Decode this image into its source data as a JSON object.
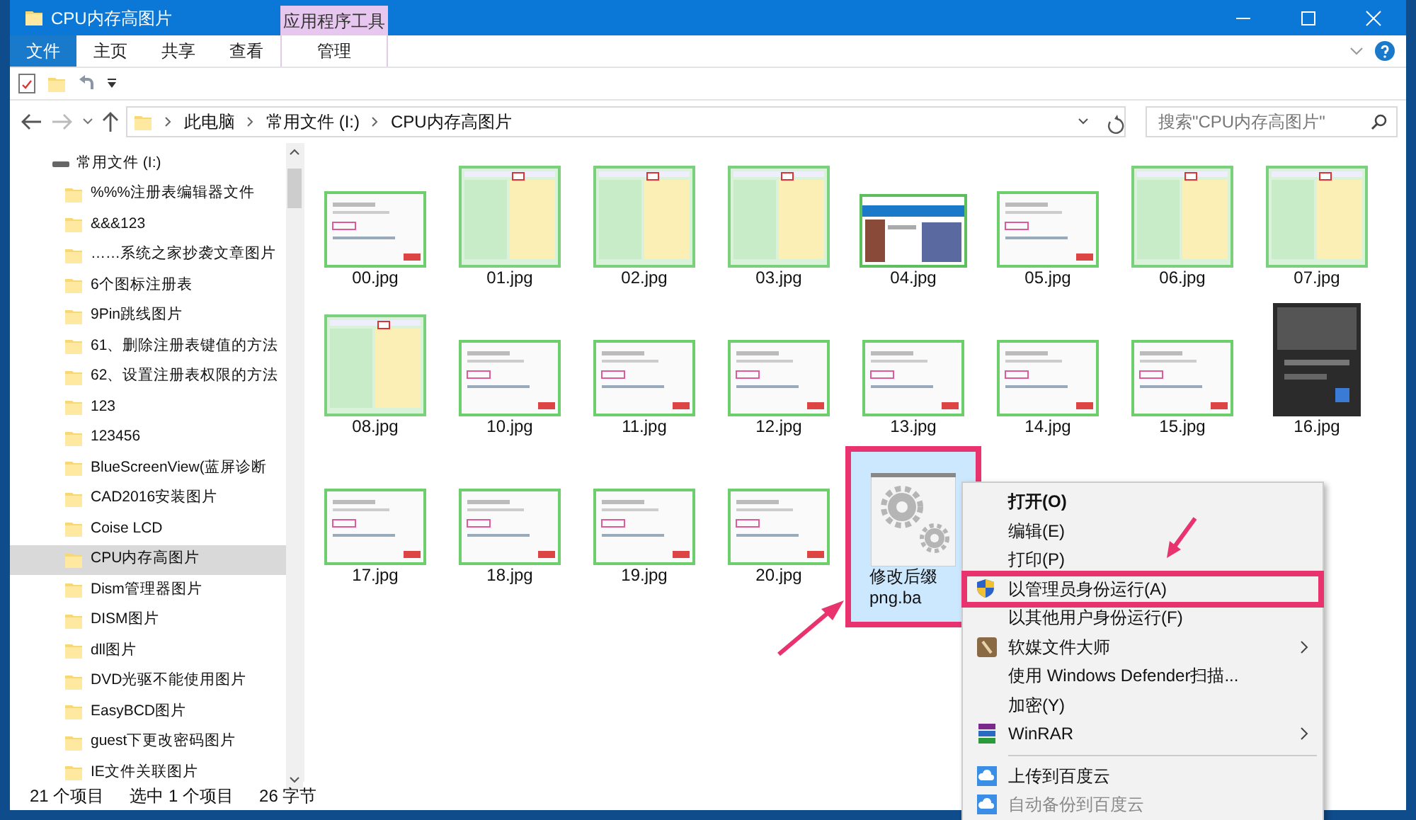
{
  "window": {
    "title": "CPU内存高图片",
    "context_group": "应用程序工具"
  },
  "ribbon_tabs": [
    {
      "label": "文件",
      "kind": "file",
      "selected": false
    },
    {
      "label": "主页",
      "kind": "normal",
      "selected": false
    },
    {
      "label": "共享",
      "kind": "normal",
      "selected": false
    },
    {
      "label": "查看",
      "kind": "normal",
      "selected": false
    },
    {
      "label": "管理",
      "kind": "contextual",
      "selected": false
    }
  ],
  "address_bar": {
    "breadcrumbs": [
      "此电脑",
      "常用文件 (I:)",
      "CPU内存高图片"
    ]
  },
  "search": {
    "placeholder": "搜索\"CPU内存高图片\""
  },
  "nav_tree": [
    {
      "label": "常用文件 (I:)",
      "kind": "drive",
      "selected": false,
      "children": [
        {
          "label": "%%%注册表编辑器文件",
          "kind": "folder",
          "selected": false
        },
        {
          "label": "&&&123",
          "kind": "folder",
          "selected": false
        },
        {
          "label": "……系统之家抄袭文章图片",
          "kind": "folder",
          "selected": false
        },
        {
          "label": "6个图标注册表",
          "kind": "folder",
          "selected": false
        },
        {
          "label": "9Pin跳线图片",
          "kind": "folder",
          "selected": false
        },
        {
          "label": "61、删除注册表键值的方法",
          "kind": "folder",
          "selected": false
        },
        {
          "label": "62、设置注册表权限的方法",
          "kind": "folder",
          "selected": false
        },
        {
          "label": "123",
          "kind": "folder",
          "selected": false
        },
        {
          "label": "123456",
          "kind": "folder",
          "selected": false
        },
        {
          "label": "BlueScreenView(蓝屏诊断",
          "kind": "folder",
          "selected": false
        },
        {
          "label": "CAD2016安装图片",
          "kind": "folder",
          "selected": false
        },
        {
          "label": "Coise LCD",
          "kind": "folder",
          "selected": false
        },
        {
          "label": "CPU内存高图片",
          "kind": "folder",
          "selected": true
        },
        {
          "label": "Dism管理器图片",
          "kind": "folder",
          "selected": false
        },
        {
          "label": "DISM图片",
          "kind": "folder",
          "selected": false
        },
        {
          "label": "dll图片",
          "kind": "folder",
          "selected": false
        },
        {
          "label": "DVD光驱不能使用图片",
          "kind": "folder",
          "selected": false
        },
        {
          "label": "EasyBCD图片",
          "kind": "folder",
          "selected": false
        },
        {
          "label": "guest下更改密码图片",
          "kind": "folder",
          "selected": false
        },
        {
          "label": "IE文件关联图片",
          "kind": "folder",
          "selected": false
        }
      ]
    }
  ],
  "files": [
    {
      "name_lines": [
        "00.jpg"
      ],
      "kind": "picture",
      "selected": false,
      "highlighted": false
    },
    {
      "name_lines": [
        "01.jpg"
      ],
      "kind": "picture",
      "selected": false,
      "highlighted": false
    },
    {
      "name_lines": [
        "02.jpg"
      ],
      "kind": "picture",
      "selected": false,
      "highlighted": false
    },
    {
      "name_lines": [
        "03.jpg"
      ],
      "kind": "picture",
      "selected": false,
      "highlighted": false
    },
    {
      "name_lines": [
        "04.jpg"
      ],
      "kind": "picture",
      "selected": false,
      "highlighted": false
    },
    {
      "name_lines": [
        "05.jpg"
      ],
      "kind": "picture",
      "selected": false,
      "highlighted": false
    },
    {
      "name_lines": [
        "06.jpg"
      ],
      "kind": "picture",
      "selected": false,
      "highlighted": false
    },
    {
      "name_lines": [
        "07.jpg"
      ],
      "kind": "picture",
      "selected": false,
      "highlighted": false
    },
    {
      "name_lines": [
        "08.jpg"
      ],
      "kind": "picture",
      "selected": false,
      "highlighted": false
    },
    {
      "name_lines": [
        "10.jpg"
      ],
      "kind": "picture",
      "selected": false,
      "highlighted": false
    },
    {
      "name_lines": [
        "11.jpg"
      ],
      "kind": "picture",
      "selected": false,
      "highlighted": false
    },
    {
      "name_lines": [
        "12.jpg"
      ],
      "kind": "picture",
      "selected": false,
      "highlighted": false
    },
    {
      "name_lines": [
        "13.jpg"
      ],
      "kind": "picture",
      "selected": false,
      "highlighted": false
    },
    {
      "name_lines": [
        "14.jpg"
      ],
      "kind": "picture",
      "selected": false,
      "highlighted": false
    },
    {
      "name_lines": [
        "15.jpg"
      ],
      "kind": "picture",
      "selected": false,
      "highlighted": false
    },
    {
      "name_lines": [
        "16.jpg"
      ],
      "kind": "picture",
      "selected": false,
      "highlighted": false
    },
    {
      "name_lines": [
        "17.jpg"
      ],
      "kind": "picture",
      "selected": false,
      "highlighted": false
    },
    {
      "name_lines": [
        "18.jpg"
      ],
      "kind": "picture",
      "selected": false,
      "highlighted": false
    },
    {
      "name_lines": [
        "19.jpg"
      ],
      "kind": "picture",
      "selected": false,
      "highlighted": false
    },
    {
      "name_lines": [
        "20.jpg"
      ],
      "kind": "picture",
      "selected": false,
      "highlighted": false
    },
    {
      "name_lines": [
        "修改后缀",
        "png.ba"
      ],
      "kind": "batch",
      "selected": true,
      "highlighted": true
    }
  ],
  "context_menu": {
    "items": [
      {
        "label": "打开(O)",
        "kind": "default",
        "submenu": false,
        "highlighted": false,
        "disabled": false
      },
      {
        "label": "编辑(E)",
        "kind": "plain",
        "submenu": false,
        "highlighted": false,
        "disabled": false
      },
      {
        "label": "打印(P)",
        "kind": "plain",
        "submenu": false,
        "highlighted": false,
        "disabled": false
      },
      {
        "label": "以管理员身份运行(A)",
        "kind": "shield",
        "submenu": false,
        "highlighted": true,
        "disabled": false
      },
      {
        "label": "以其他用户身份运行(F)",
        "kind": "plain",
        "submenu": false,
        "highlighted": false,
        "disabled": false
      },
      {
        "label": "软媒文件大师",
        "kind": "app",
        "submenu": true,
        "highlighted": false,
        "disabled": false
      },
      {
        "label": "使用 Windows Defender扫描...",
        "kind": "plain",
        "submenu": false,
        "highlighted": false,
        "disabled": false
      },
      {
        "label": "加密(Y)",
        "kind": "plain",
        "submenu": false,
        "highlighted": false,
        "disabled": false
      },
      {
        "label": "WinRAR",
        "kind": "archive",
        "submenu": true,
        "highlighted": false,
        "disabled": false
      },
      {
        "kind": "separator"
      },
      {
        "label": "上传到百度云",
        "kind": "cloud",
        "submenu": false,
        "highlighted": false,
        "disabled": false
      },
      {
        "label": "自动备份到百度云",
        "kind": "cloud",
        "submenu": false,
        "highlighted": false,
        "disabled": true
      }
    ]
  },
  "status_bar": {
    "item_count": "21 个项目",
    "selection": "选中 1 个项目",
    "size": "26 字节"
  }
}
